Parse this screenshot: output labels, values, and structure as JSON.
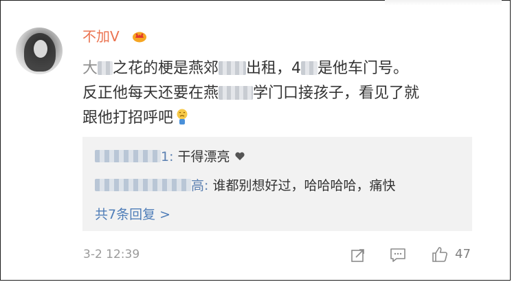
{
  "post": {
    "username": "不加V",
    "vip_badge_icon": "crown-badge-icon",
    "comment": {
      "line1_a": "大",
      "line1_b": "之花的梗是燕郊",
      "line1_c": "出租，4",
      "line1_d": "是他车门号。",
      "line2_a": "反正他每天还要在燕",
      "line2_b": "学门口接孩子，看见了就",
      "line3": "跟他打招呼吧",
      "emoji_icon": "crying-emoji-icon"
    }
  },
  "replies": {
    "items": [
      {
        "name_suffix": "1:",
        "text": "干得漂亮",
        "icon": "heart-icon"
      },
      {
        "name_suffix": "高:",
        "text": "谁都别想好过，哈哈哈哈，痛快"
      }
    ],
    "more_label": "共7条回复 >"
  },
  "footer": {
    "timestamp": "3-2 12:39",
    "like_count": "47",
    "icons": [
      "share-icon",
      "comment-icon",
      "like-icon"
    ]
  },
  "colors": {
    "username": "#eb7350",
    "link": "#4f7db8",
    "reply_bg": "#f2f2f2",
    "text": "#333333",
    "meta": "#9a9a9a"
  }
}
